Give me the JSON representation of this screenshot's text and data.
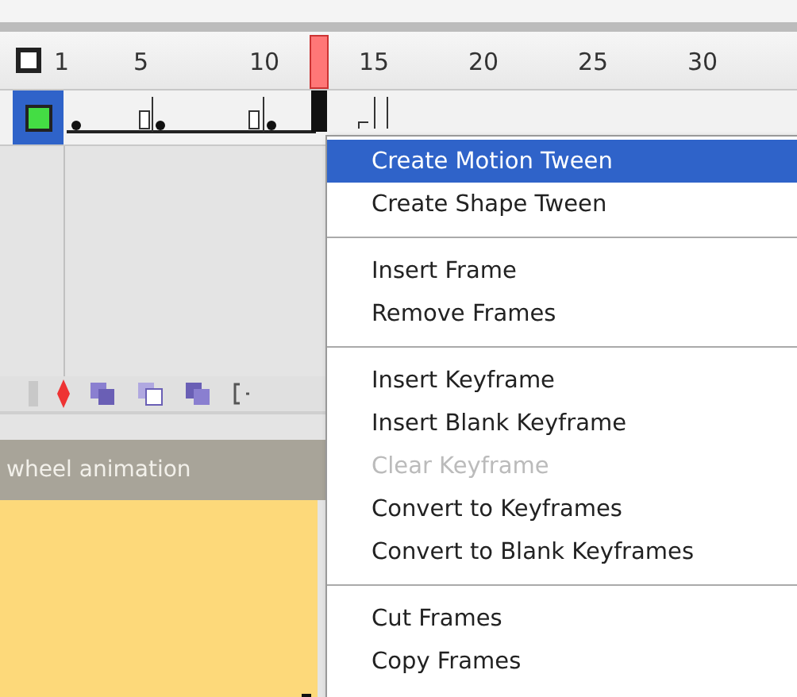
{
  "timeline": {
    "ruler_labels": [
      "1",
      "5",
      "10",
      "15",
      "20",
      "25",
      "30"
    ]
  },
  "layer_bar": {
    "title": "wheel animation"
  },
  "context_menu": {
    "groups": [
      [
        {
          "label": "Create Motion Tween",
          "selected": true,
          "disabled": false
        },
        {
          "label": "Create Shape Tween",
          "selected": false,
          "disabled": false
        }
      ],
      [
        {
          "label": "Insert Frame",
          "selected": false,
          "disabled": false
        },
        {
          "label": "Remove Frames",
          "selected": false,
          "disabled": false
        }
      ],
      [
        {
          "label": "Insert Keyframe",
          "selected": false,
          "disabled": false
        },
        {
          "label": "Insert Blank Keyframe",
          "selected": false,
          "disabled": false
        },
        {
          "label": "Clear Keyframe",
          "selected": false,
          "disabled": true
        },
        {
          "label": "Convert to Keyframes",
          "selected": false,
          "disabled": false
        },
        {
          "label": "Convert to Blank Keyframes",
          "selected": false,
          "disabled": false
        }
      ],
      [
        {
          "label": "Cut Frames",
          "selected": false,
          "disabled": false
        },
        {
          "label": "Copy Frames",
          "selected": false,
          "disabled": false
        }
      ]
    ]
  }
}
